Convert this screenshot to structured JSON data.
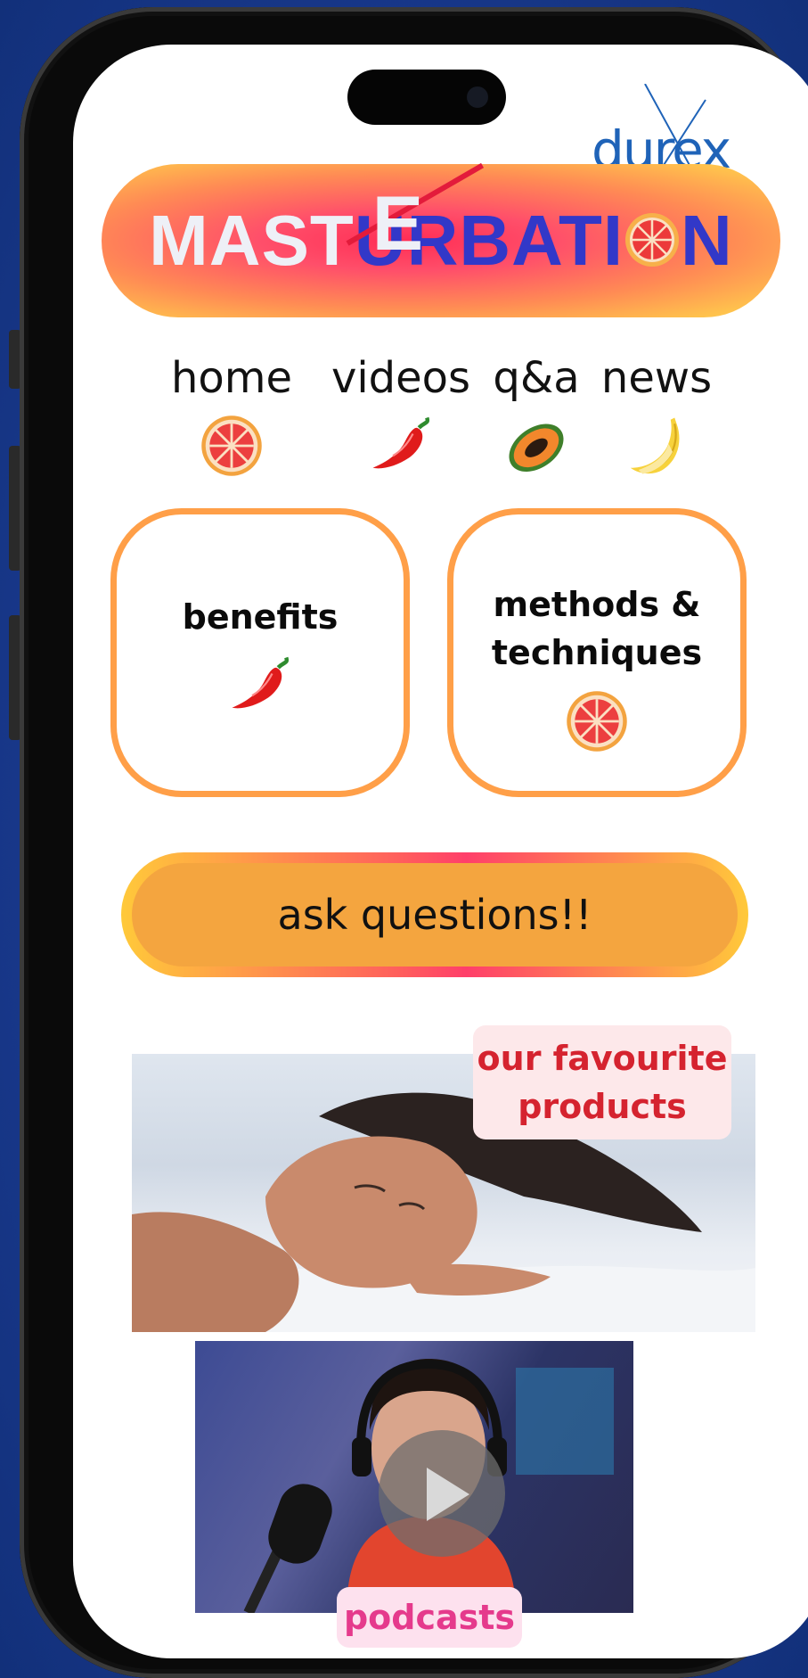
{
  "brand": {
    "logo_text": "durex",
    "logo_color": "#1f63b8"
  },
  "hero": {
    "title_prefix": "MAST",
    "title_struck": "UR",
    "title_insert": "E",
    "title_blue_part": "BATI",
    "title_suffix": "N",
    "accent_colors": [
      "#ff2d55",
      "#ffc04d",
      "#3238c8"
    ]
  },
  "nav": {
    "items": [
      {
        "label": "home",
        "icon": "grapefruit-icon"
      },
      {
        "label": "videos",
        "icon": "chili-pepper-icon"
      },
      {
        "label": "q&a",
        "icon": "papaya-icon"
      },
      {
        "label": "news",
        "icon": "banana-icon"
      }
    ]
  },
  "cards": {
    "benefits": {
      "label": "benefits",
      "icon": "chili-pepper-icon"
    },
    "methods": {
      "label_line1": "methods &",
      "label_line2": "techniques",
      "icon": "grapefruit-icon"
    },
    "border_color": "#ff9f48"
  },
  "ask": {
    "label": "ask questions!!"
  },
  "products": {
    "tag_line1": "our favourite",
    "tag_line2": "products",
    "tag_color": "#d5232f"
  },
  "podcasts": {
    "tag": "podcasts",
    "tag_color": "#e53a8c"
  }
}
